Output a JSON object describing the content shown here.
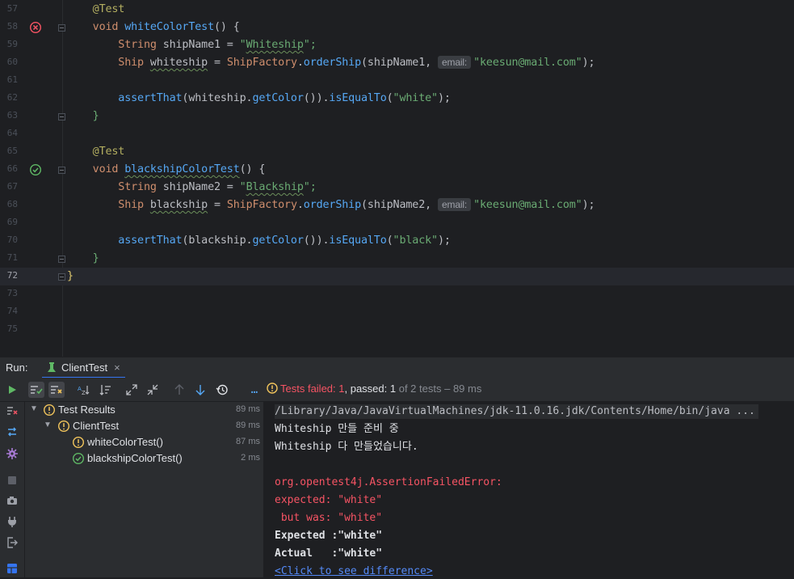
{
  "editor": {
    "lines": [
      {
        "num": "57",
        "parts": [
          [
            "    ",
            ""
          ],
          [
            "@Test",
            "ann"
          ]
        ]
      },
      {
        "num": "58",
        "parts": [
          [
            "    ",
            ""
          ],
          [
            "void ",
            "kw"
          ],
          [
            "whiteColorTest",
            "fn"
          ],
          [
            "() {",
            ""
          ]
        ]
      },
      {
        "num": "59",
        "parts": [
          [
            "        ",
            ""
          ],
          [
            "String ",
            "kw"
          ],
          [
            "shipName1 = ",
            ""
          ],
          [
            "\"",
            "str"
          ],
          [
            "Whiteship",
            "str wavy"
          ],
          [
            "\";",
            "str"
          ]
        ]
      },
      {
        "num": "60",
        "parts": [
          [
            "        ",
            ""
          ],
          [
            "Ship ",
            "kw"
          ],
          [
            "whiteship",
            "wavy"
          ],
          [
            " = ",
            ""
          ],
          [
            "ShipFactory",
            "kw"
          ],
          [
            ".",
            ""
          ],
          [
            "orderShip",
            "fn"
          ],
          [
            "(shipName1, ",
            ""
          ],
          [
            "email:",
            "hint"
          ],
          [
            "\"keesun@mail.com\"",
            "str"
          ],
          [
            ");",
            ""
          ]
        ]
      },
      {
        "num": "61",
        "parts": []
      },
      {
        "num": "62",
        "parts": [
          [
            "        ",
            ""
          ],
          [
            "assertThat",
            "fn"
          ],
          [
            "(whiteship.",
            ""
          ],
          [
            "getColor",
            "fn"
          ],
          [
            "()).",
            ""
          ],
          [
            "isEqualTo",
            "fn"
          ],
          [
            "(",
            ""
          ],
          [
            "\"white\"",
            "str"
          ],
          [
            ");",
            ""
          ]
        ]
      },
      {
        "num": "63",
        "parts": [
          [
            "    ",
            ""
          ],
          [
            "}",
            "str"
          ]
        ]
      },
      {
        "num": "64",
        "parts": []
      },
      {
        "num": "65",
        "parts": [
          [
            "    ",
            ""
          ],
          [
            "@Test",
            "ann"
          ]
        ]
      },
      {
        "num": "66",
        "parts": [
          [
            "    ",
            ""
          ],
          [
            "void ",
            "kw"
          ],
          [
            "blackshipColorTest",
            "fn wavy"
          ],
          [
            "() {",
            ""
          ]
        ]
      },
      {
        "num": "67",
        "parts": [
          [
            "        ",
            ""
          ],
          [
            "String ",
            "kw"
          ],
          [
            "shipName2 = ",
            ""
          ],
          [
            "\"",
            "str"
          ],
          [
            "Blackship",
            "str wavy"
          ],
          [
            "\";",
            "str"
          ]
        ]
      },
      {
        "num": "68",
        "parts": [
          [
            "        ",
            ""
          ],
          [
            "Ship ",
            "kw"
          ],
          [
            "blackship",
            "wavy"
          ],
          [
            " = ",
            ""
          ],
          [
            "ShipFactory",
            "kw"
          ],
          [
            ".",
            ""
          ],
          [
            "orderShip",
            "fn"
          ],
          [
            "(shipName2, ",
            ""
          ],
          [
            "email:",
            "hint"
          ],
          [
            "\"keesun@mail.com\"",
            "str"
          ],
          [
            ");",
            ""
          ]
        ]
      },
      {
        "num": "69",
        "parts": []
      },
      {
        "num": "70",
        "parts": [
          [
            "        ",
            ""
          ],
          [
            "assertThat",
            "fn"
          ],
          [
            "(blackship.",
            ""
          ],
          [
            "getColor",
            "fn"
          ],
          [
            "()).",
            ""
          ],
          [
            "isEqualTo",
            "fn"
          ],
          [
            "(",
            ""
          ],
          [
            "\"black\"",
            "str"
          ],
          [
            ");",
            ""
          ]
        ]
      },
      {
        "num": "71",
        "parts": [
          [
            "    ",
            ""
          ],
          [
            "}",
            "str"
          ]
        ]
      },
      {
        "num": "72",
        "parts": [
          [
            "}",
            "brace-y"
          ]
        ]
      },
      {
        "num": "73",
        "parts": []
      },
      {
        "num": "74",
        "parts": []
      },
      {
        "num": "75",
        "parts": []
      }
    ]
  },
  "run": {
    "label": "Run:",
    "tab_label": "ClientTest",
    "close": "×",
    "status": {
      "prefix": "Tests failed: ",
      "failed": "1",
      "mid": ", passed: ",
      "passed": "1",
      "of": " of 2 tests",
      "time": " – 89 ms"
    },
    "more": "…"
  },
  "tree": {
    "root": {
      "label": "Test Results",
      "time": "89 ms"
    },
    "suite": {
      "label": "ClientTest",
      "time": "89 ms"
    },
    "tests": [
      {
        "label": "whiteColorTest()",
        "time": "87 ms",
        "status": "failed"
      },
      {
        "label": "blackshipColorTest()",
        "time": "2 ms",
        "status": "passed"
      }
    ]
  },
  "console": {
    "lines": [
      {
        "text": "/Library/Java/JavaVirtualMachines/jdk-11.0.16.jdk/Contents/Home/bin/java ...",
        "style": "path"
      },
      {
        "text": "Whiteship 만들 준비 중",
        "style": ""
      },
      {
        "text": "Whiteship 다 만들었습니다.",
        "style": ""
      },
      {
        "text": "",
        "style": ""
      },
      {
        "text": "org.opentest4j.AssertionFailedError:",
        "style": "red"
      },
      {
        "text": "expected: \"white\"",
        "style": "red"
      },
      {
        "text": " but was: \"white\"",
        "style": "red"
      },
      {
        "text": "Expected :\"white\"",
        "style": "bold"
      },
      {
        "text": "Actual   :\"white\"",
        "style": "bold"
      },
      {
        "text": "<Click to see difference>",
        "style": "link"
      }
    ]
  },
  "colors": {
    "failed": "#f2c55c",
    "passed": "#5fb865",
    "error": "#f75464",
    "accent": "#3574f0"
  }
}
